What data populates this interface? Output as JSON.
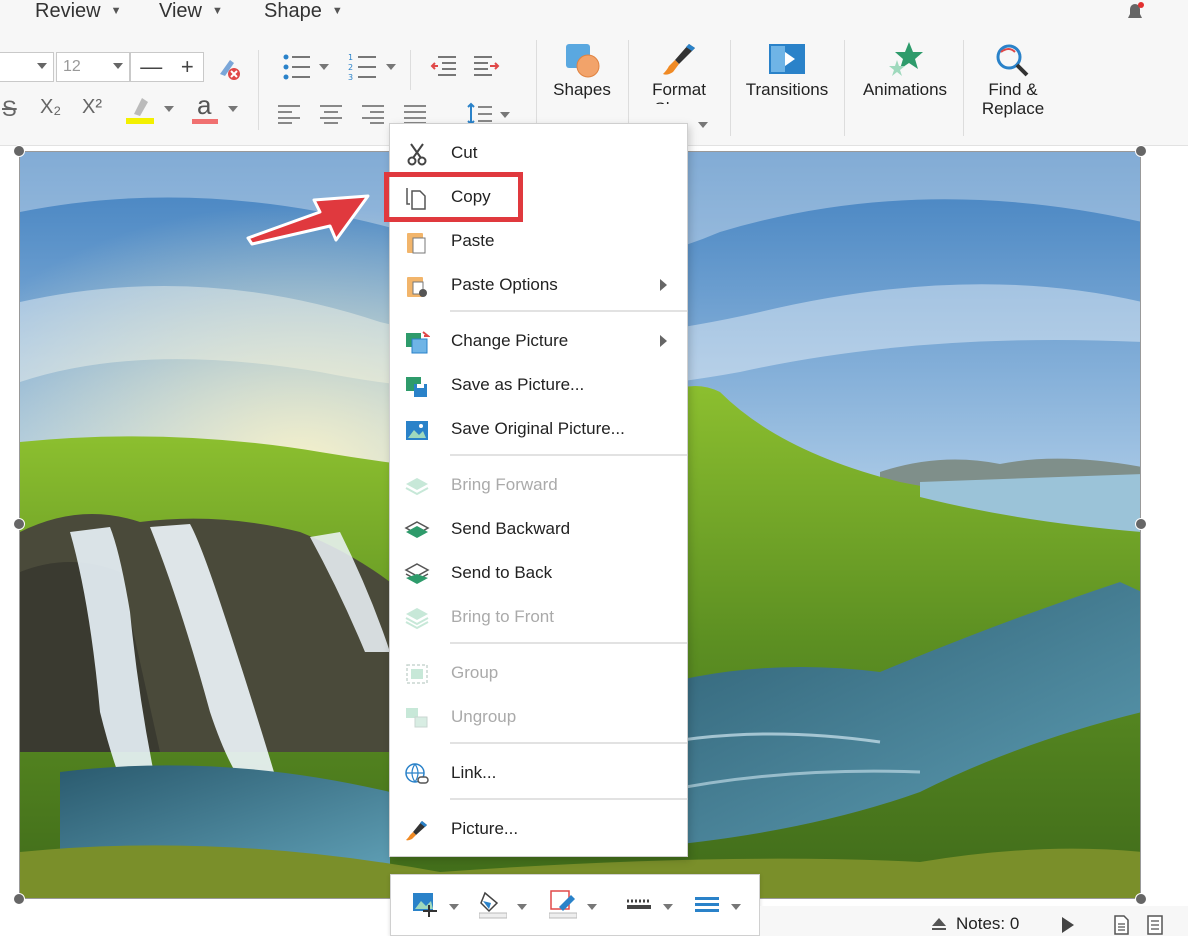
{
  "menubar": {
    "items": [
      {
        "label": "Review"
      },
      {
        "label": "View"
      },
      {
        "label": "Shape"
      }
    ]
  },
  "ribbon": {
    "font_size_value": "12",
    "spin_minus": "—",
    "spin_plus": "+",
    "subscript_label": "X₂",
    "superscript_label": "X²",
    "font_color_letter": "a",
    "strike_letter": "S",
    "buttons": {
      "shapes": "Shapes",
      "format_shape": "Format\nShape",
      "transitions": "Transitions",
      "animations": "Animations",
      "find_replace": "Find &\nReplace"
    }
  },
  "context_menu": {
    "items": [
      {
        "label": "Cut",
        "icon": "scissors-icon",
        "enabled": true
      },
      {
        "label": "Copy",
        "icon": "copy-icon",
        "enabled": true
      },
      {
        "label": "Paste",
        "icon": "paste-icon",
        "enabled": true
      },
      {
        "label": "Paste Options",
        "icon": "paste-options-icon",
        "enabled": true,
        "submenu": true
      },
      {
        "label": "Change Picture",
        "icon": "change-picture-icon",
        "enabled": true,
        "submenu": true
      },
      {
        "label": "Save as Picture...",
        "icon": "save-as-picture-icon",
        "enabled": true
      },
      {
        "label": "Save Original Picture...",
        "icon": "save-original-picture-icon",
        "enabled": true
      },
      {
        "label": "Bring Forward",
        "icon": "bring-forward-icon",
        "enabled": false
      },
      {
        "label": "Send Backward",
        "icon": "send-backward-icon",
        "enabled": true
      },
      {
        "label": "Send to Back",
        "icon": "send-to-back-icon",
        "enabled": true
      },
      {
        "label": "Bring to Front",
        "icon": "bring-to-front-icon",
        "enabled": false
      },
      {
        "label": "Group",
        "icon": "group-icon",
        "enabled": false
      },
      {
        "label": "Ungroup",
        "icon": "ungroup-icon",
        "enabled": false
      },
      {
        "label": "Link...",
        "icon": "link-icon",
        "enabled": true
      },
      {
        "label": "Picture...",
        "icon": "picture-brush-icon",
        "enabled": true
      }
    ]
  },
  "status": {
    "notes_label": "Notes: 0"
  },
  "colors": {
    "highlight": "#e0393e",
    "accent_green": "#2e9b6b",
    "accent_blue": "#2a82c9"
  }
}
